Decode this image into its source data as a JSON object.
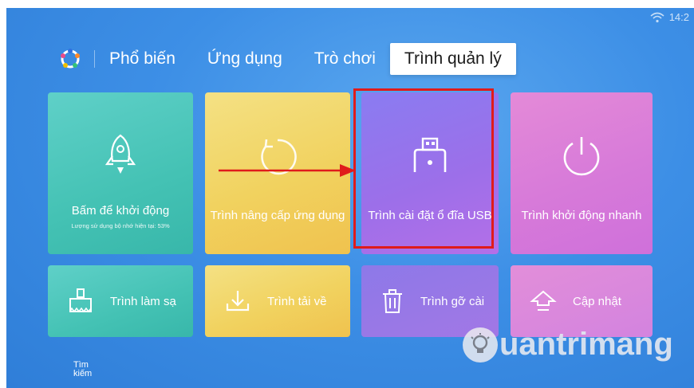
{
  "status": {
    "time": "14:2"
  },
  "tabs": [
    {
      "label": "Phổ biến"
    },
    {
      "label": "Ứng dụng"
    },
    {
      "label": "Trò chơi"
    },
    {
      "label": "Trình quản lý"
    }
  ],
  "tiles": {
    "launch": {
      "label": "Bấm để khởi động",
      "sub": "Lượng sử dụng bộ nhớ hiện tại: 53%"
    },
    "upgrade": {
      "label": "Trình nâng cấp ứng dụng"
    },
    "usb": {
      "label": "Trình cài đặt ổ đĩa USB"
    },
    "quickboot": {
      "label": "Trình khởi động nhanh"
    },
    "clean": {
      "label": "Trình làm sạ"
    },
    "download": {
      "label": "Trình tải về"
    },
    "uninstall": {
      "label": "Trình gỡ cài"
    },
    "update": {
      "label": "Cập nhật"
    }
  },
  "search": {
    "line1": "Tìm",
    "line2": "kiếm"
  },
  "watermark": {
    "text": "uantrimang"
  },
  "colors": {
    "highlight": "#e01b1b",
    "background": "#3d8fe6"
  },
  "icons": [
    "wifi-icon",
    "logo-icon",
    "rocket-icon",
    "refresh-icon",
    "usb-icon",
    "power-icon",
    "broom-icon",
    "download-icon",
    "trash-icon",
    "update-icon"
  ]
}
